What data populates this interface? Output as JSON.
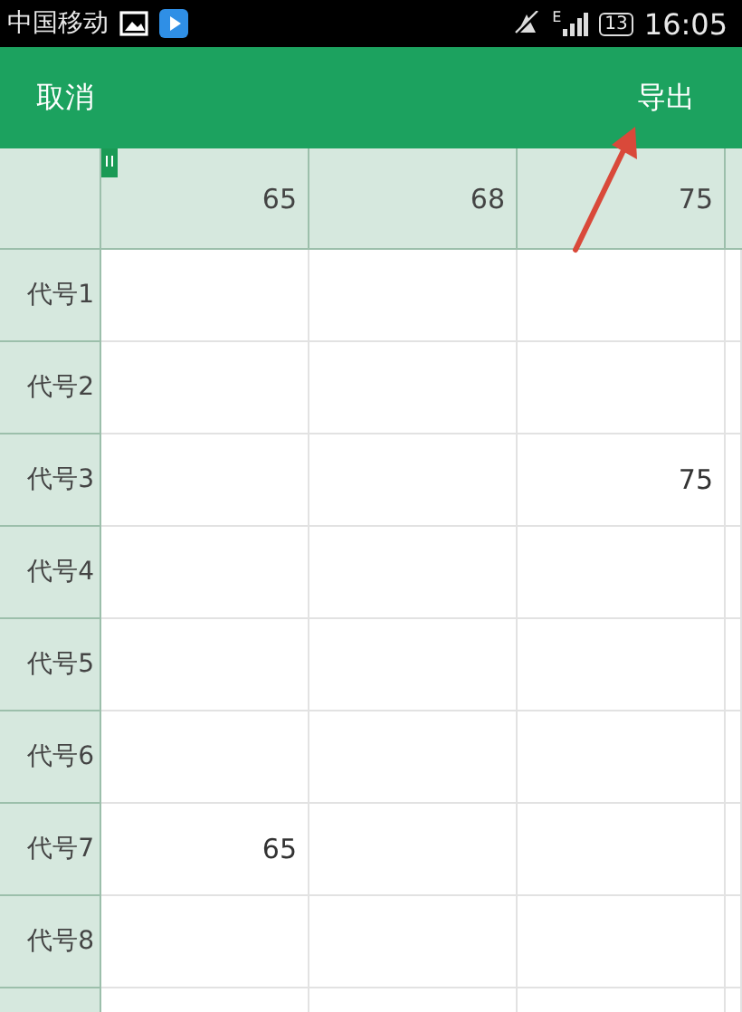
{
  "status_bar": {
    "carrier": "中国移动",
    "network": "E",
    "battery": "13",
    "time": "16:05"
  },
  "header": {
    "cancel": "取消",
    "export": "导出"
  },
  "table": {
    "columns": [
      {
        "heading": "65"
      },
      {
        "heading": "68"
      },
      {
        "heading": "75"
      }
    ],
    "rows": [
      {
        "label": "代号1"
      },
      {
        "label": "代号2"
      },
      {
        "label": "代号3",
        "column_3": "75"
      },
      {
        "label": "代号4"
      },
      {
        "label": "代号5"
      },
      {
        "label": "代号6"
      },
      {
        "label": "代号7",
        "column_1": "65"
      },
      {
        "label": "代号8"
      }
    ]
  }
}
